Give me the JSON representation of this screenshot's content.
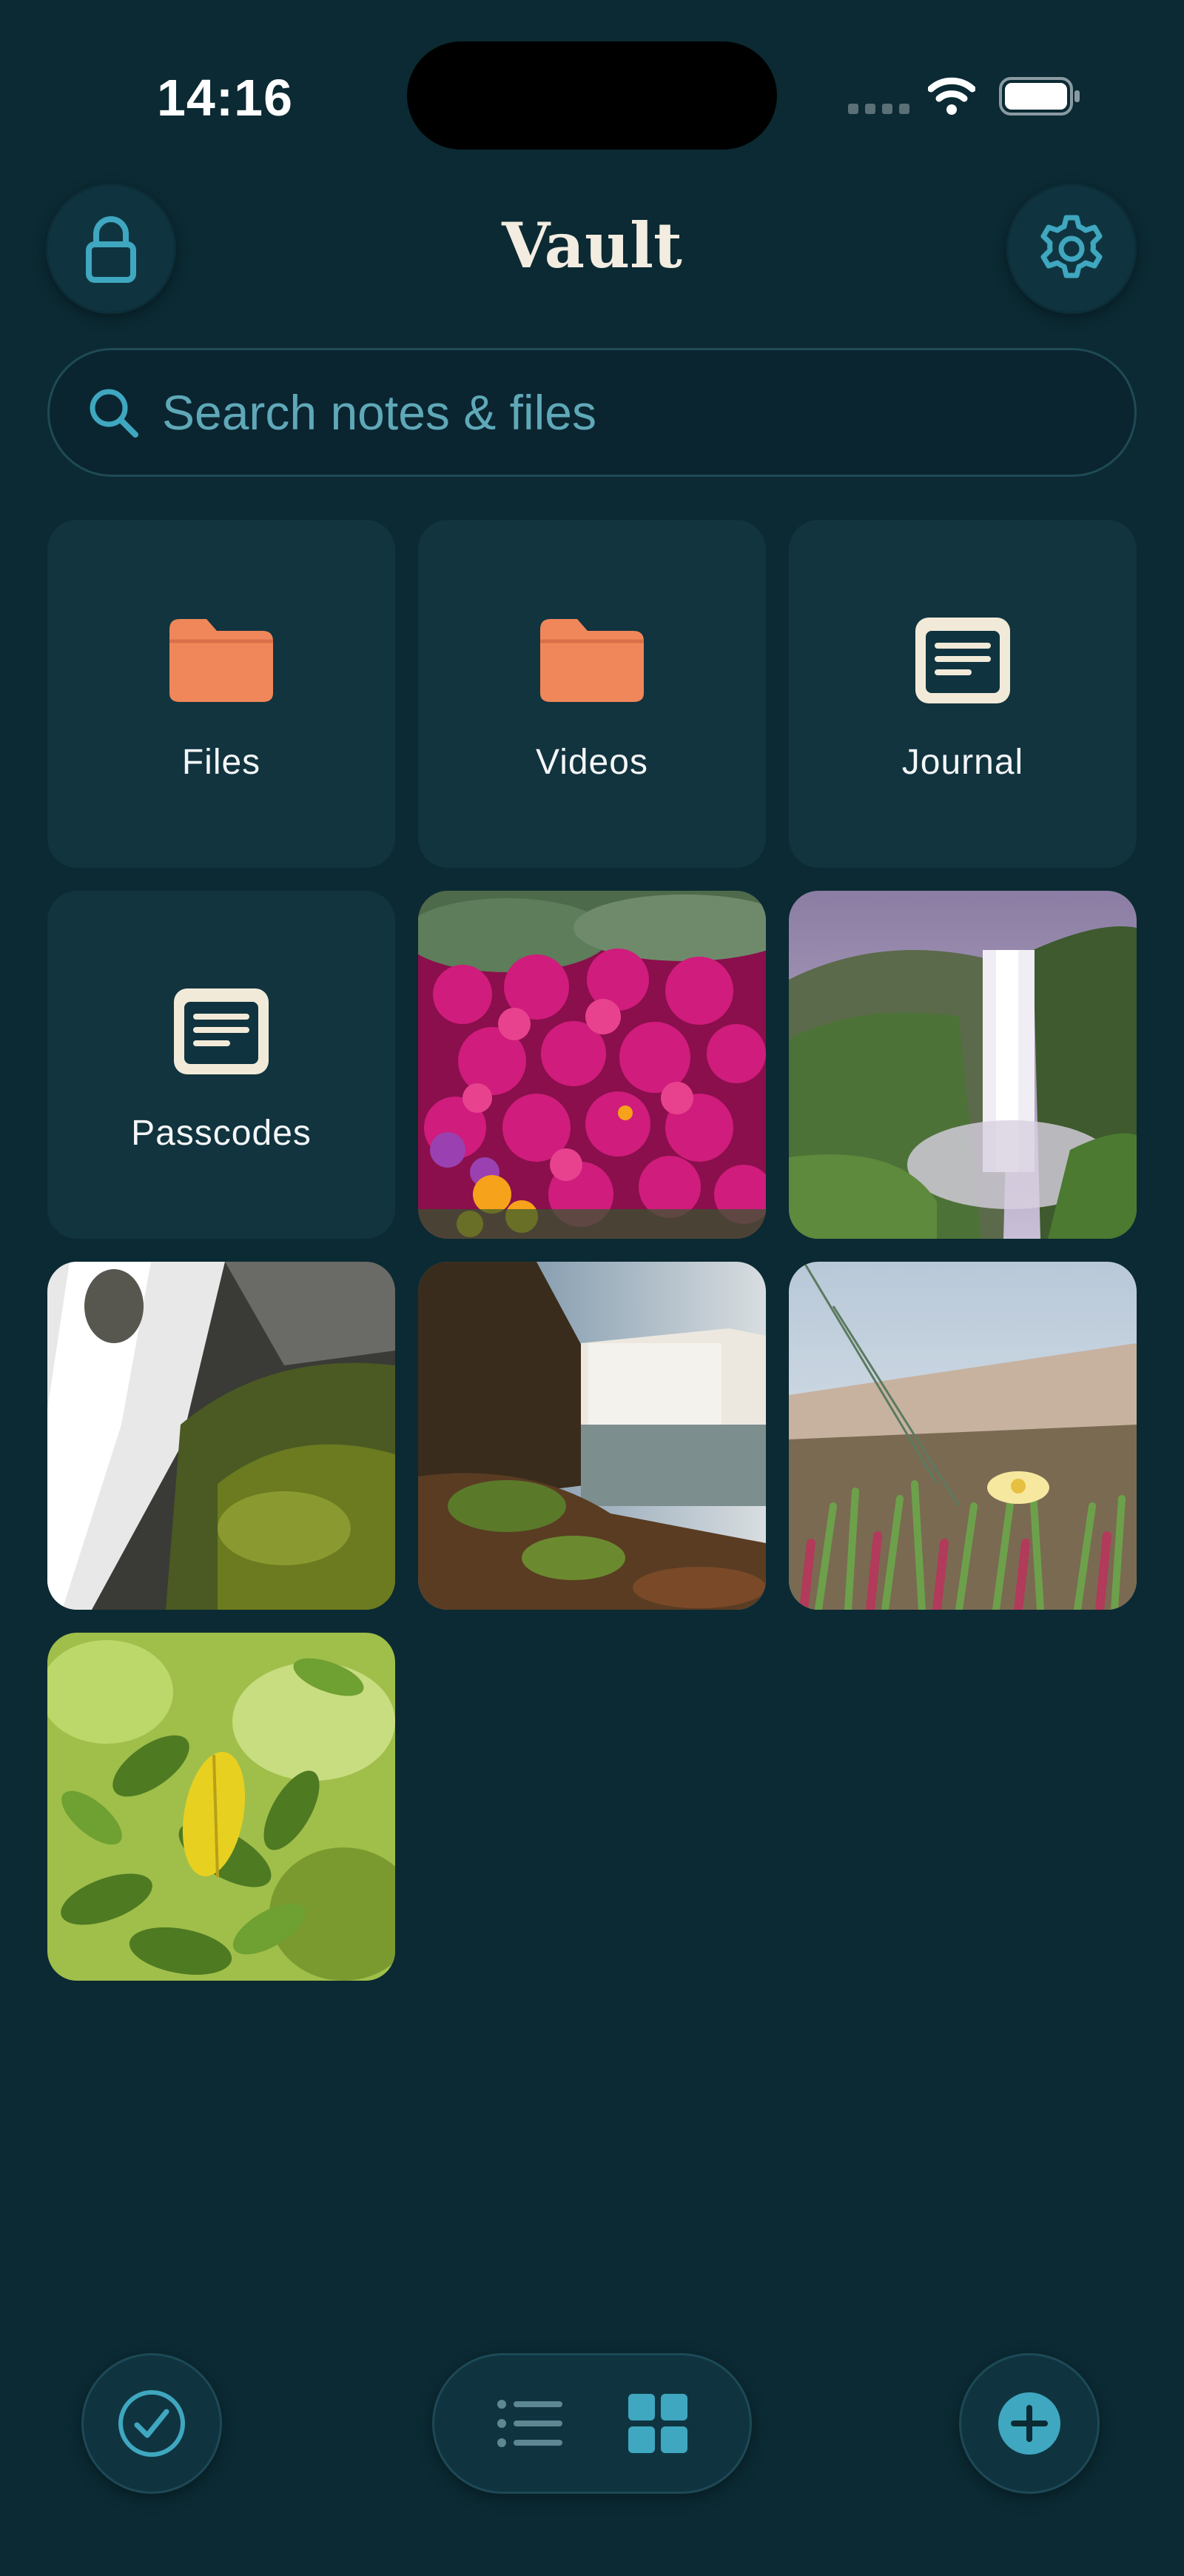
{
  "status_bar": {
    "time": "14:16"
  },
  "header": {
    "title": "Vault",
    "lock_icon": "lock-icon",
    "settings_icon": "gear-icon"
  },
  "search": {
    "placeholder": "Search notes & files",
    "value": ""
  },
  "folders": [
    {
      "label": "Files",
      "icon": "folder-icon"
    },
    {
      "label": "Videos",
      "icon": "folder-icon"
    },
    {
      "label": "Journal",
      "icon": "note-icon"
    },
    {
      "label": "Passcodes",
      "icon": "note-icon"
    }
  ],
  "photos": [
    {
      "subject": "pink-flowers"
    },
    {
      "subject": "misty-waterfall"
    },
    {
      "subject": "mossy-waterfall"
    },
    {
      "subject": "waterfall-cliff"
    },
    {
      "subject": "coastal-ice-plant"
    },
    {
      "subject": "green-leaves"
    }
  ],
  "toolbar": {
    "select_icon": "checkmark-circle-icon",
    "list_view_icon": "list-icon",
    "grid_view_icon": "grid-icon",
    "active_view": "grid",
    "add_icon": "plus-icon"
  },
  "colors": {
    "background": "#0b2a33",
    "tile": "#11343f",
    "accent": "#3fa7bf",
    "folder": "#f0875a",
    "note": "#f2ead8",
    "title": "#f3ece0"
  }
}
